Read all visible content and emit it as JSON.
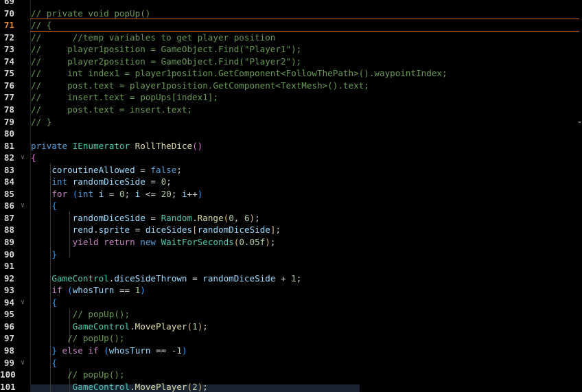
{
  "editor": {
    "active_line_number": "71",
    "lines": [
      {
        "num": "69",
        "tokens": []
      },
      {
        "num": "70",
        "tokens": [
          {
            "c": "c",
            "t": "// private void popUp()"
          }
        ]
      },
      {
        "num": "71",
        "tokens": [
          {
            "c": "c",
            "t": "// {"
          }
        ]
      },
      {
        "num": "72",
        "tokens": [
          {
            "c": "c",
            "t": "//      //temp variables to get player position"
          }
        ]
      },
      {
        "num": "73",
        "tokens": [
          {
            "c": "c",
            "t": "//     player1position = GameObject.Find(\"Player1\");"
          }
        ]
      },
      {
        "num": "74",
        "tokens": [
          {
            "c": "c",
            "t": "//     player2position = GameObject.Find(\"Player2\");"
          }
        ]
      },
      {
        "num": "75",
        "tokens": [
          {
            "c": "c",
            "t": "//     int index1 = player1position.GetComponent<FollowThePath>().waypointIndex;"
          }
        ]
      },
      {
        "num": "76",
        "tokens": [
          {
            "c": "c",
            "t": "//     post.text = player1position.GetComponent<TextMesh>().text;"
          }
        ]
      },
      {
        "num": "77",
        "tokens": [
          {
            "c": "c",
            "t": "//     insert.text = popUps[index1];"
          }
        ]
      },
      {
        "num": "78",
        "tokens": [
          {
            "c": "c",
            "t": "//     post.text = insert.text;"
          }
        ]
      },
      {
        "num": "79",
        "tokens": [
          {
            "c": "c",
            "t": "// }"
          }
        ]
      },
      {
        "num": "80",
        "tokens": []
      },
      {
        "num": "81",
        "tokens": [
          {
            "c": "k",
            "t": "private "
          },
          {
            "c": "t",
            "t": "IEnumerator "
          },
          {
            "c": "f",
            "t": "RollTheDice"
          },
          {
            "c": "b2",
            "t": "()"
          }
        ]
      },
      {
        "num": "82",
        "fold": true,
        "tokens": [
          {
            "c": "b2",
            "t": "{"
          }
        ]
      },
      {
        "num": "83",
        "tokens": [
          {
            "c": "p",
            "t": "    "
          },
          {
            "c": "v",
            "t": "coroutineAllowed"
          },
          {
            "c": "p",
            "t": " = "
          },
          {
            "c": "k",
            "t": "false"
          },
          {
            "c": "p",
            "t": ";"
          }
        ]
      },
      {
        "num": "84",
        "tokens": [
          {
            "c": "p",
            "t": "    "
          },
          {
            "c": "k",
            "t": "int "
          },
          {
            "c": "v",
            "t": "randomDiceSide"
          },
          {
            "c": "p",
            "t": " = "
          },
          {
            "c": "n",
            "t": "0"
          },
          {
            "c": "p",
            "t": ";"
          }
        ]
      },
      {
        "num": "85",
        "tokens": [
          {
            "c": "p",
            "t": "    "
          },
          {
            "c": "ctl",
            "t": "for "
          },
          {
            "c": "b3",
            "t": "("
          },
          {
            "c": "k",
            "t": "int "
          },
          {
            "c": "v",
            "t": "i"
          },
          {
            "c": "p",
            "t": " = "
          },
          {
            "c": "n",
            "t": "0"
          },
          {
            "c": "p",
            "t": "; "
          },
          {
            "c": "v",
            "t": "i"
          },
          {
            "c": "p",
            "t": " <= "
          },
          {
            "c": "n",
            "t": "20"
          },
          {
            "c": "p",
            "t": "; "
          },
          {
            "c": "v",
            "t": "i"
          },
          {
            "c": "p",
            "t": "++"
          },
          {
            "c": "b3",
            "t": ")"
          }
        ]
      },
      {
        "num": "86",
        "fold": true,
        "tokens": [
          {
            "c": "p",
            "t": "    "
          },
          {
            "c": "b3",
            "t": "{"
          }
        ]
      },
      {
        "num": "87",
        "tokens": [
          {
            "c": "p",
            "t": "        "
          },
          {
            "c": "v",
            "t": "randomDiceSide"
          },
          {
            "c": "p",
            "t": " = "
          },
          {
            "c": "t",
            "t": "Random"
          },
          {
            "c": "p",
            "t": "."
          },
          {
            "c": "f",
            "t": "Range"
          },
          {
            "c": "b1",
            "t": "("
          },
          {
            "c": "n",
            "t": "0"
          },
          {
            "c": "p",
            "t": ", "
          },
          {
            "c": "n",
            "t": "6"
          },
          {
            "c": "b1",
            "t": ")"
          },
          {
            "c": "p",
            "t": ";"
          }
        ]
      },
      {
        "num": "88",
        "tokens": [
          {
            "c": "p",
            "t": "        "
          },
          {
            "c": "v",
            "t": "rend"
          },
          {
            "c": "p",
            "t": "."
          },
          {
            "c": "v",
            "t": "sprite"
          },
          {
            "c": "p",
            "t": " = "
          },
          {
            "c": "v",
            "t": "diceSides"
          },
          {
            "c": "b1",
            "t": "["
          },
          {
            "c": "v",
            "t": "randomDiceSide"
          },
          {
            "c": "b1",
            "t": "]"
          },
          {
            "c": "p",
            "t": ";"
          }
        ]
      },
      {
        "num": "89",
        "tokens": [
          {
            "c": "p",
            "t": "        "
          },
          {
            "c": "ctl",
            "t": "yield return "
          },
          {
            "c": "k",
            "t": "new "
          },
          {
            "c": "t",
            "t": "WaitForSeconds"
          },
          {
            "c": "b1",
            "t": "("
          },
          {
            "c": "n",
            "t": "0.05f"
          },
          {
            "c": "b1",
            "t": ")"
          },
          {
            "c": "p",
            "t": ";"
          }
        ]
      },
      {
        "num": "90",
        "tokens": [
          {
            "c": "p",
            "t": "    "
          },
          {
            "c": "b3",
            "t": "}"
          }
        ]
      },
      {
        "num": "91",
        "tokens": []
      },
      {
        "num": "92",
        "tokens": [
          {
            "c": "p",
            "t": "    "
          },
          {
            "c": "t",
            "t": "GameControl"
          },
          {
            "c": "p",
            "t": "."
          },
          {
            "c": "v",
            "t": "diceSideThrown"
          },
          {
            "c": "p",
            "t": " = "
          },
          {
            "c": "v",
            "t": "randomDiceSide"
          },
          {
            "c": "p",
            "t": " + "
          },
          {
            "c": "n",
            "t": "1"
          },
          {
            "c": "p",
            "t": ";"
          }
        ]
      },
      {
        "num": "93",
        "tokens": [
          {
            "c": "p",
            "t": "    "
          },
          {
            "c": "ctl",
            "t": "if "
          },
          {
            "c": "b3",
            "t": "("
          },
          {
            "c": "v",
            "t": "whosTurn"
          },
          {
            "c": "p",
            "t": " == "
          },
          {
            "c": "n",
            "t": "1"
          },
          {
            "c": "b3",
            "t": ")"
          }
        ]
      },
      {
        "num": "94",
        "fold": true,
        "tokens": [
          {
            "c": "p",
            "t": "    "
          },
          {
            "c": "b3",
            "t": "{"
          }
        ]
      },
      {
        "num": "95",
        "tokens": [
          {
            "c": "p",
            "t": "        "
          },
          {
            "c": "c",
            "t": "// popUp();"
          }
        ]
      },
      {
        "num": "96",
        "tokens": [
          {
            "c": "p",
            "t": "        "
          },
          {
            "c": "t",
            "t": "GameControl"
          },
          {
            "c": "p",
            "t": "."
          },
          {
            "c": "f",
            "t": "MovePlayer"
          },
          {
            "c": "b1",
            "t": "("
          },
          {
            "c": "n",
            "t": "1"
          },
          {
            "c": "b1",
            "t": ")"
          },
          {
            "c": "p",
            "t": ";"
          }
        ]
      },
      {
        "num": "97",
        "tokens": [
          {
            "c": "p",
            "t": "       "
          },
          {
            "c": "c",
            "t": "// popUp();"
          }
        ]
      },
      {
        "num": "98",
        "tokens": [
          {
            "c": "p",
            "t": "    "
          },
          {
            "c": "b3",
            "t": "} "
          },
          {
            "c": "ctl",
            "t": "else if "
          },
          {
            "c": "b3",
            "t": "("
          },
          {
            "c": "v",
            "t": "whosTurn"
          },
          {
            "c": "p",
            "t": " == -"
          },
          {
            "c": "n",
            "t": "1"
          },
          {
            "c": "b3",
            "t": ")"
          }
        ]
      },
      {
        "num": "99",
        "fold": true,
        "tokens": [
          {
            "c": "p",
            "t": "    "
          },
          {
            "c": "b3",
            "t": "{"
          }
        ]
      },
      {
        "num": "100",
        "tokens": [
          {
            "c": "p",
            "t": "       "
          },
          {
            "c": "c",
            "t": "// popUp();"
          }
        ]
      },
      {
        "num": "101",
        "tokens": [
          {
            "c": "p",
            "t": "        "
          },
          {
            "c": "t",
            "t": "GameControl"
          },
          {
            "c": "p",
            "t": "."
          },
          {
            "c": "f",
            "t": "MovePlayer"
          },
          {
            "c": "b1",
            "t": "("
          },
          {
            "c": "n",
            "t": "2"
          },
          {
            "c": "b1",
            "t": ")"
          },
          {
            "c": "p",
            "t": ";"
          }
        ]
      }
    ]
  }
}
